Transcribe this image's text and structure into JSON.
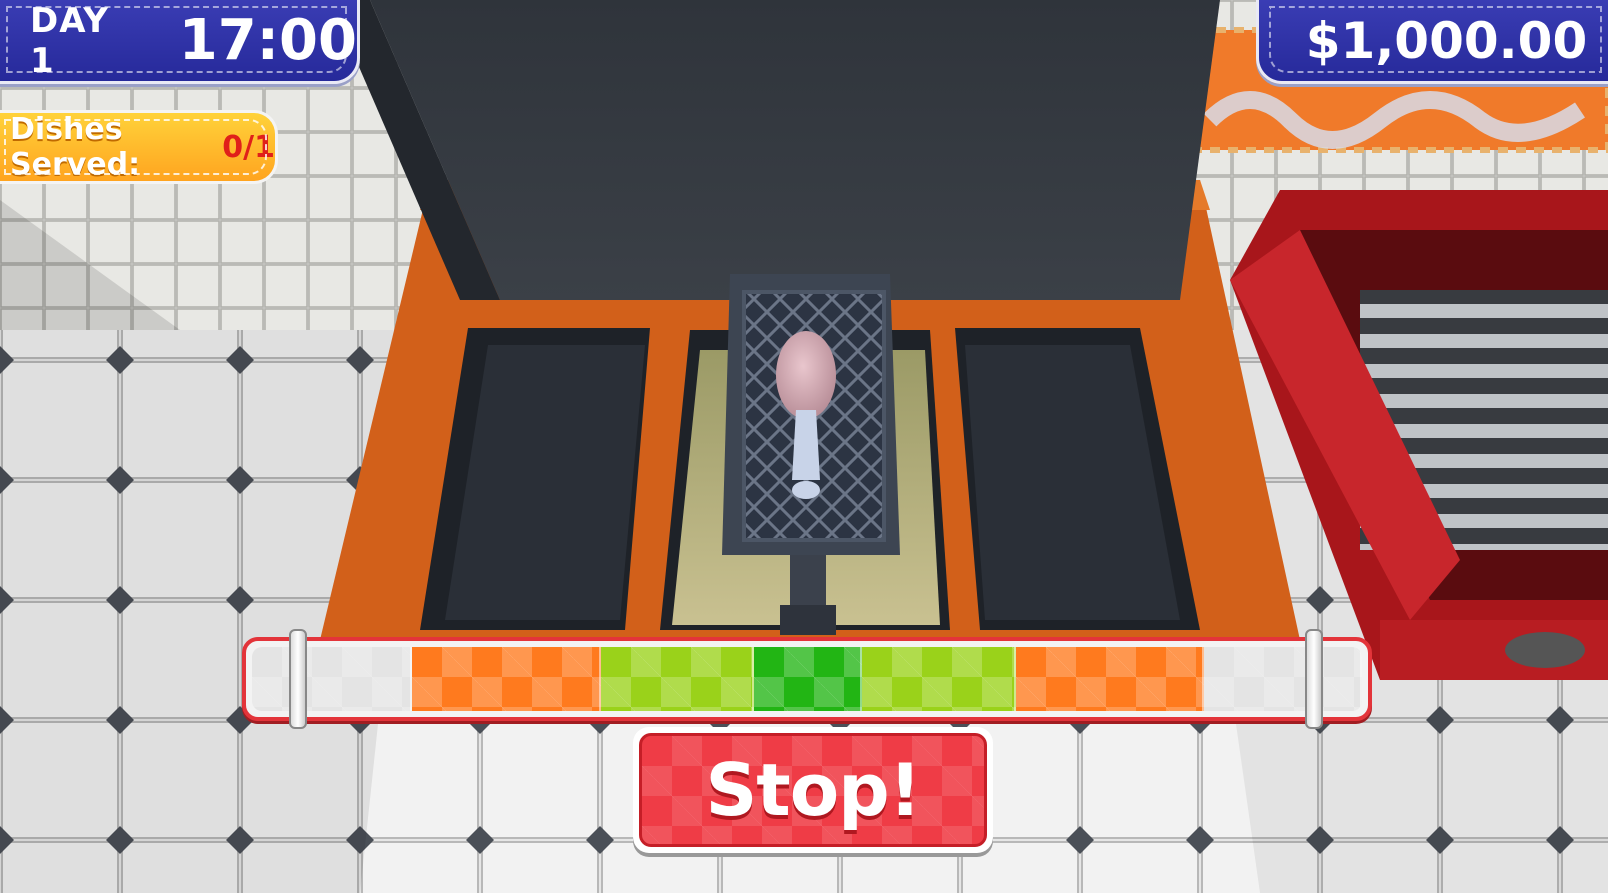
{
  "hud": {
    "day_label": "DAY 1",
    "clock": "17:00",
    "money": "$1,000.00",
    "dishes_label": "Dishes Served:",
    "dishes_count": "0/1"
  },
  "timing_bar": {
    "segments": [
      {
        "zone": "white",
        "fraction": 0.144,
        "color": "#e4e4e4"
      },
      {
        "zone": "orange",
        "fraction": 0.17,
        "color": "#ff7a1e"
      },
      {
        "zone": "lime",
        "fraction": 0.138,
        "color": "#9ad21a"
      },
      {
        "zone": "green",
        "fraction": 0.098,
        "color": "#22b514"
      },
      {
        "zone": "lime",
        "fraction": 0.138,
        "color": "#9ad21a"
      },
      {
        "zone": "orange",
        "fraction": 0.17,
        "color": "#ff7a1e"
      },
      {
        "zone": "white",
        "fraction": 0.142,
        "color": "#e4e4e4"
      }
    ],
    "marker_positions": [
      0.046,
      0.952
    ]
  },
  "stop_button": {
    "label": "Stop!"
  },
  "colors": {
    "hud_blue": "#2e31a6",
    "dishes_yellow": "#ffc02d",
    "stop_red": "#ef3c46",
    "bar_border": "#e3343a"
  }
}
